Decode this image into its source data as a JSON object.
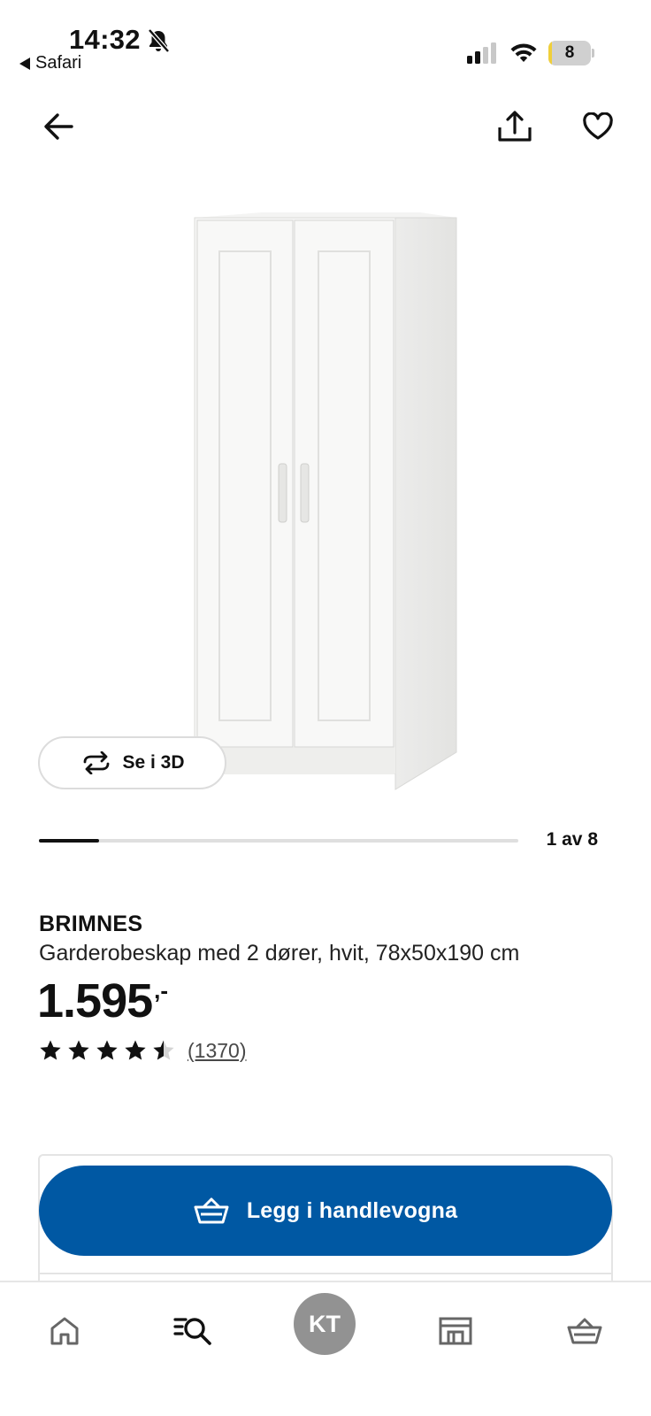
{
  "status_bar": {
    "time": "14:32",
    "back_app": "Safari",
    "battery_level": "8",
    "battery_fraction": 0.08,
    "icons": [
      "bell-slash-icon",
      "signal-icon",
      "wifi-icon",
      "battery-icon"
    ]
  },
  "nav": {
    "icons": [
      "arrow-left-icon",
      "share-icon",
      "heart-icon"
    ]
  },
  "gallery": {
    "view_3d_label": "Se i 3D",
    "view_3d_icon": "rotate-3d-icon",
    "counter": "1 av 8",
    "current": 1,
    "total": 8
  },
  "product": {
    "name": "BRIMNES",
    "description": "Garderobeskap med 2 dører, hvit, 78x50x190 cm",
    "price": "1.595",
    "price_suffix": ",-",
    "rating": 4.5,
    "rating_max": 5,
    "review_count": "(1370)"
  },
  "cart": {
    "add_label": "Legg i handlevogna",
    "icon": "shopping-basket-icon",
    "button_color": "#0058a3"
  },
  "tab_bar": {
    "profile_initials": "KT",
    "icons": [
      "home-icon",
      "search-list-icon",
      "avatar",
      "store-icon",
      "basket-icon"
    ]
  }
}
